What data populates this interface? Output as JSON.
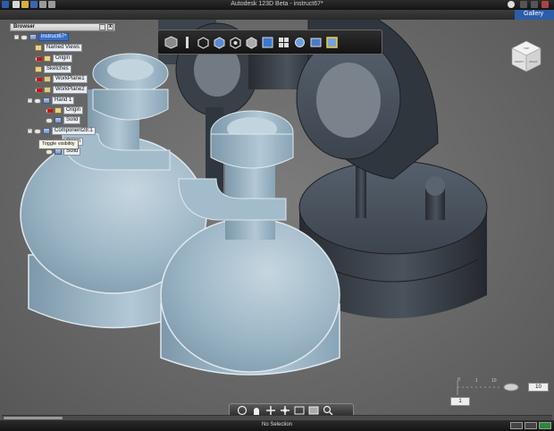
{
  "app": {
    "title": "Autodesk 123D Beta - instruct67*"
  },
  "gallery": {
    "label": "Gallery"
  },
  "browser": {
    "header": "Browser",
    "close_label": "X",
    "nodes": [
      {
        "label": "instruct67*",
        "selected": true
      },
      {
        "label": "Named Views"
      },
      {
        "label": "Origin"
      },
      {
        "label": "Sketches"
      },
      {
        "label": "WorkPlane1"
      },
      {
        "label": "WorkPlane2"
      },
      {
        "label": "Hand 1"
      },
      {
        "label": "Origin"
      },
      {
        "label": "Solid"
      },
      {
        "label": "Component28:1"
      },
      {
        "label": "Origin"
      },
      {
        "label": "Solid"
      }
    ],
    "tooltip": "Toggle visibility"
  },
  "toolbar": {
    "icons": [
      "home-view-icon",
      "look-at-icon",
      "isometric-view-icon",
      "top-view-icon",
      "front-view-icon",
      "perspective-icon",
      "shaded-view-icon",
      "multi-view-icon",
      "visual-style-icon",
      "3d-snap-icon",
      "grid-toggle-icon"
    ]
  },
  "viewcube": {
    "front": "FRONT",
    "right": "RIGHT",
    "top": "TOP"
  },
  "navbar": {
    "icons": [
      "orbit-icon",
      "pan-icon",
      "zoom-icon",
      "fit-all-icon",
      "zoom-window-icon",
      "look-icon",
      "view-selected-icon"
    ]
  },
  "grid": {
    "value": "10",
    "snap": "1",
    "ticks": [
      "0",
      "1",
      "10"
    ]
  },
  "status": {
    "message": "No Selection"
  },
  "colors": {
    "accent": "#2c5da8",
    "part_light": "#9cb6c6",
    "part_dark": "#3a4048"
  }
}
